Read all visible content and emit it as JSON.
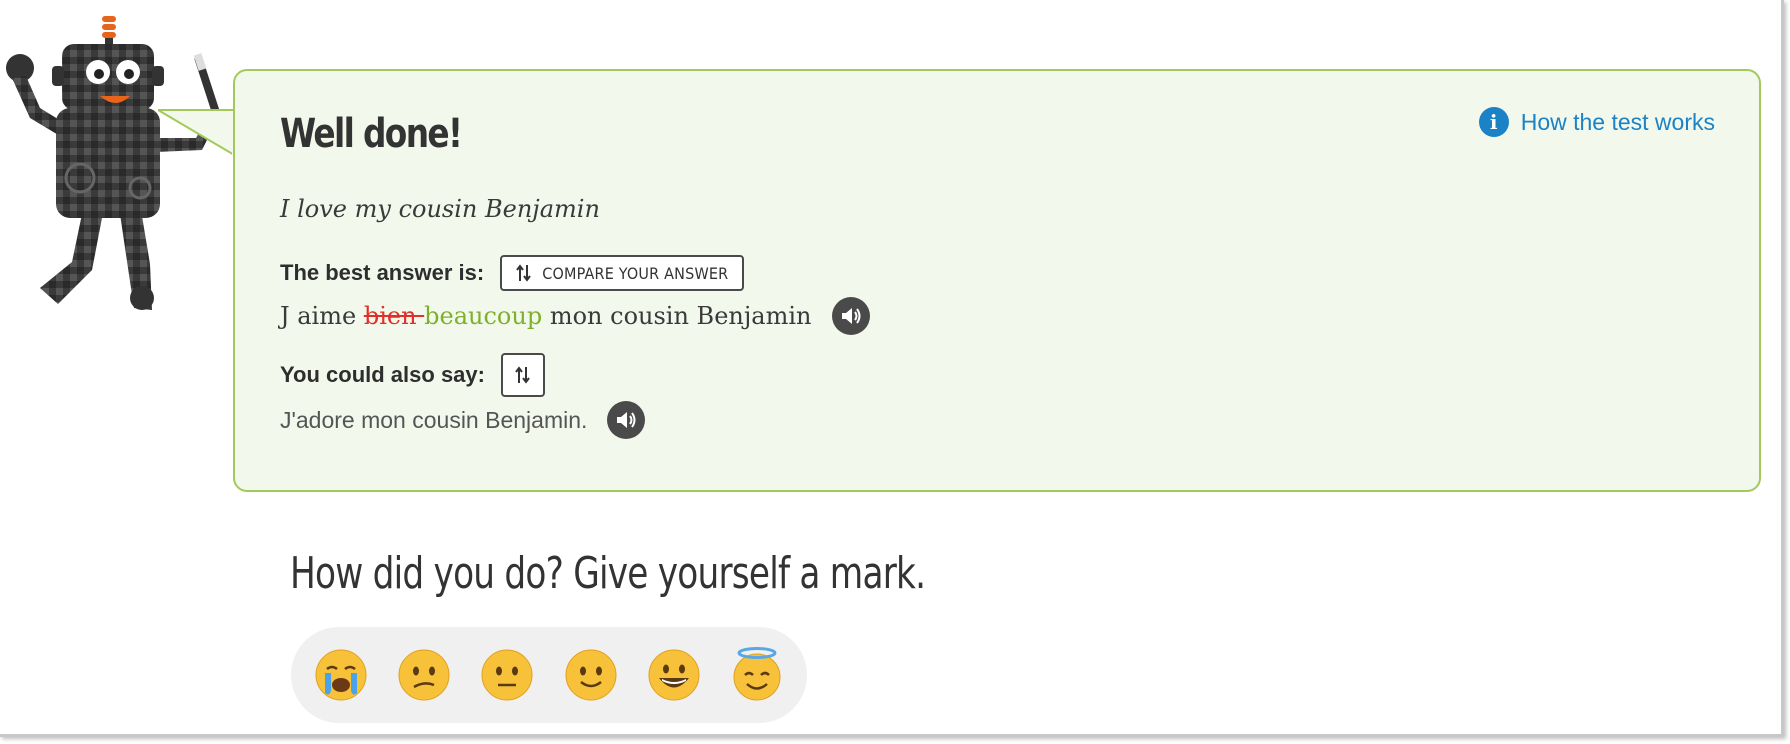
{
  "feedback": {
    "title": "Well done!",
    "help_link": "How the test works",
    "prompt": "I love my cousin Benjamin",
    "best_label": "The best answer is:",
    "compare_label": "COMPARE YOUR ANSWER",
    "best_answer": {
      "before": "J aime ",
      "removed": "bien ",
      "added": "beaucoup",
      "after": " mon cousin Benjamin"
    },
    "also_label": "You could also say:",
    "alternative": "J'adore mon cousin Benjamin."
  },
  "rating": {
    "heading": "How did you do? Give yourself a mark.",
    "options": [
      "crying-face",
      "confused-face",
      "neutral-face",
      "slightly-smiling-face",
      "grinning-face",
      "smiling-face-with-halo"
    ]
  },
  "colors": {
    "panel_bg": "#f2f9ec",
    "panel_border": "#a3c95a",
    "link": "#1b82c6",
    "removed": "#e0302a",
    "added": "#7fb02a"
  }
}
